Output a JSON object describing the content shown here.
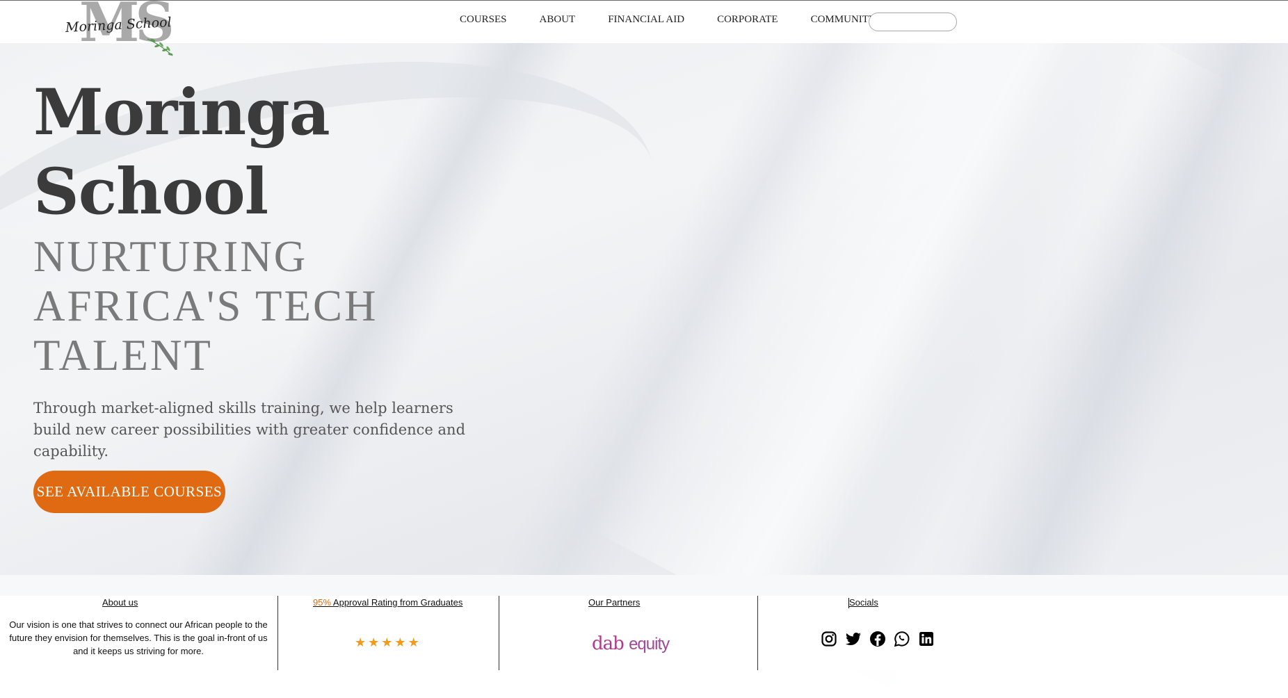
{
  "brand": {
    "logo_mark": "MS",
    "logo_script": "Moringa School"
  },
  "nav": {
    "links": [
      "COURSES",
      "ABOUT",
      "FINANCIAL AID",
      "CORPORATE",
      "COMMUNITY"
    ],
    "search_placeholder": "",
    "search_value": ""
  },
  "hero": {
    "title_line1": "Moringa",
    "title_line2": "School",
    "tagline_line1": "NURTURING",
    "tagline_line2": "AFRICA'S TECH",
    "tagline_line3": "TALENT",
    "description": "Through market-aligned skills training, we help learners build new career possibilities with greater confidence and capability.",
    "cta_label": "SEE AVAILABLE COURSES"
  },
  "footer": {
    "about": {
      "heading": "About us",
      "text": "Our vision is one that strives to connect our African people to the future they envision for themselves. This is the goal in-front of us and it keeps us striving for more."
    },
    "rating": {
      "percent": "95%",
      "heading_rest": " Approval Rating from Graduates",
      "stars": 5
    },
    "partners": {
      "heading": "Our Partners",
      "logo_text_a": "dab",
      "logo_text_b": "equity"
    },
    "socials": {
      "heading": "Socials",
      "icons": [
        "instagram-icon",
        "twitter-icon",
        "facebook-icon",
        "whatsapp-icon",
        "linkedin-icon"
      ]
    }
  },
  "colors": {
    "accent": "#e06a12",
    "title": "#3b3b3b",
    "tagline": "#7a7a7a",
    "star": "#f29a1a"
  }
}
